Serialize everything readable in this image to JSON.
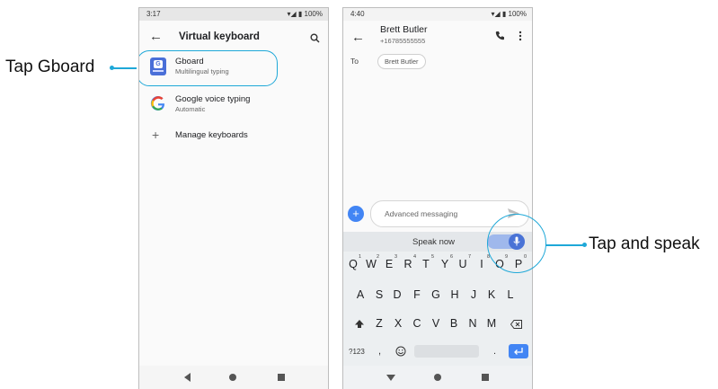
{
  "callouts": {
    "left_label": "Tap Gboard",
    "right_label": "Tap and speak",
    "color": "#1fa8d8"
  },
  "phone_left": {
    "status": {
      "time": "3:17",
      "battery": "100%"
    },
    "header": {
      "title": "Virtual keyboard",
      "back_icon": "back-arrow-icon",
      "search_icon": "search-icon"
    },
    "items": [
      {
        "title": "Gboard",
        "subtitle": "Multilingual typing",
        "icon": "gboard-icon"
      },
      {
        "title": "Google voice typing",
        "subtitle": "Automatic",
        "icon": "google-g-icon"
      },
      {
        "title": "Manage keyboards",
        "icon": "plus-icon"
      }
    ]
  },
  "phone_right": {
    "status": {
      "time": "4:40",
      "battery": "100%"
    },
    "header": {
      "name": "Brett Butler",
      "number": "+16785555555"
    },
    "to_label": "To",
    "to_chip": "Brett Butler",
    "compose": {
      "placeholder": "Advanced messaging"
    },
    "speak_now": "Speak now",
    "keyboard": {
      "row1": [
        "Q",
        "W",
        "E",
        "R",
        "T",
        "Y",
        "U",
        "I",
        "O",
        "P"
      ],
      "row1_hints": [
        "1",
        "2",
        "3",
        "4",
        "5",
        "6",
        "7",
        "8",
        "9",
        "0"
      ],
      "row2": [
        "A",
        "S",
        "D",
        "F",
        "G",
        "H",
        "J",
        "K",
        "L"
      ],
      "row3": [
        "Z",
        "X",
        "C",
        "V",
        "B",
        "N",
        "M"
      ],
      "symbols": "?123",
      "comma": ",",
      "period": "."
    },
    "accent": "#4285f4"
  }
}
